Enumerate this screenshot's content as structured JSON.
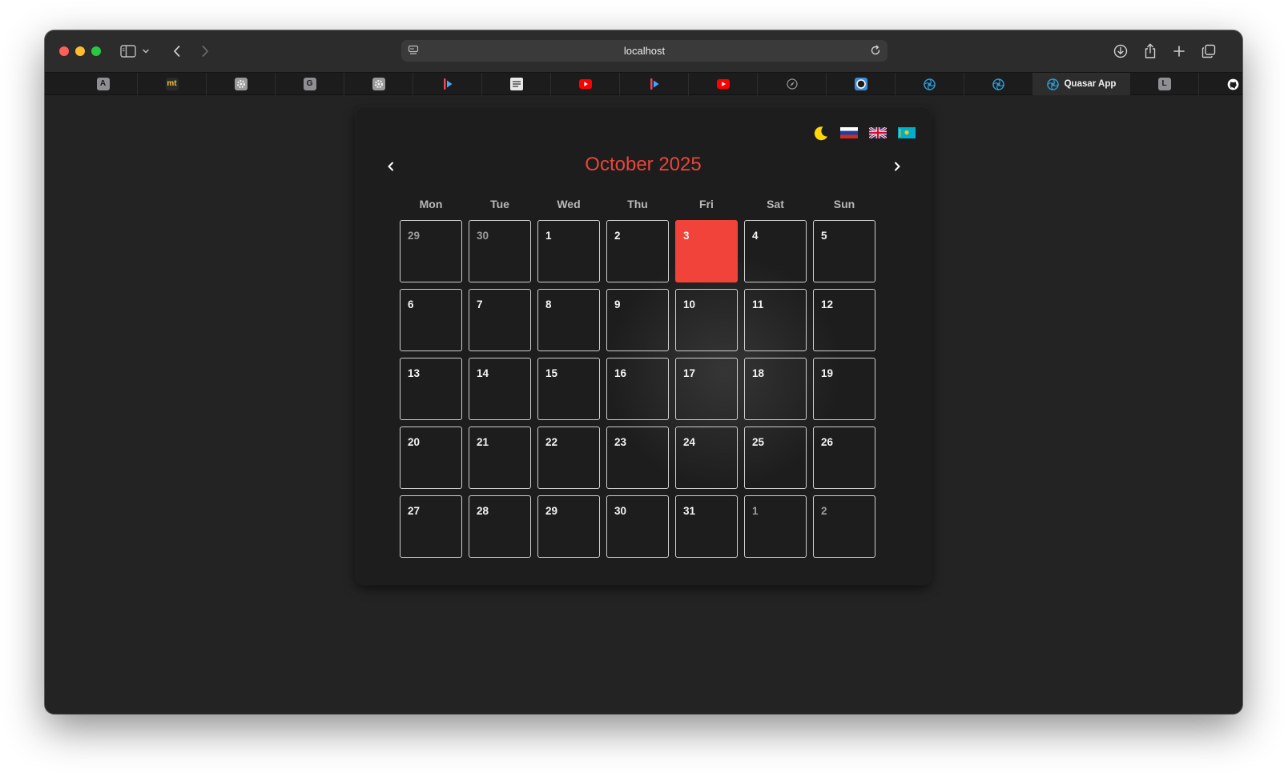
{
  "browser": {
    "url": "localhost",
    "tabs": [
      {
        "icon": "letter-a-favicon",
        "glyph": "A",
        "bg": "#8e8e93",
        "fg": "#1c1c1c"
      },
      {
        "icon": "mt-favicon",
        "glyph": "mt",
        "bg": "#2a2a2a",
        "fg": "#f2c230"
      },
      {
        "icon": "grey-gear-favicon",
        "glyph": "",
        "bg": "#9a9a9a",
        "fg": "#ffffff"
      },
      {
        "icon": "letter-g-favicon",
        "glyph": "G",
        "bg": "#8e8e93",
        "fg": "#1c1c1c"
      },
      {
        "icon": "grey-gear-favicon",
        "glyph": "",
        "bg": "#9a9a9a",
        "fg": "#ffffff"
      },
      {
        "icon": "streaming-app-favicon",
        "glyph": "",
        "bg": "#1c1c1c",
        "fg": "#e8465e"
      },
      {
        "icon": "document-favicon",
        "glyph": "",
        "bg": "#e8e8e8",
        "fg": "#222222"
      },
      {
        "icon": "youtube-favicon",
        "glyph": "",
        "bg": "#ff0000",
        "fg": "#ffffff"
      },
      {
        "icon": "streaming-app-favicon",
        "glyph": "",
        "bg": "#1c1c1c",
        "fg": "#e8465e"
      },
      {
        "icon": "youtube-favicon",
        "glyph": "",
        "bg": "#ff0000",
        "fg": "#ffffff"
      },
      {
        "icon": "compass-favicon",
        "glyph": "",
        "bg": "#1c1c1c",
        "fg": "#9a9a9a"
      },
      {
        "icon": "blue-circle-favicon",
        "glyph": "",
        "bg": "#3d8bd4",
        "fg": "#ffffff"
      },
      {
        "icon": "quasar-favicon",
        "glyph": "",
        "bg": "#1c1c1c",
        "fg": "#2a9bd8"
      },
      {
        "icon": "quasar-favicon",
        "glyph": "",
        "bg": "#1c1c1c",
        "fg": "#2a9bd8"
      },
      {
        "icon": "quasar-favicon",
        "glyph": "",
        "bg": "#1c1c1c",
        "fg": "#2a9bd8",
        "label": "Quasar App",
        "active": true
      },
      {
        "icon": "letter-l-favicon",
        "glyph": "L",
        "bg": "#8e8e93",
        "fg": "#1c1c1c"
      },
      {
        "icon": "github-favicon",
        "glyph": "",
        "bg": "#1c1c1c",
        "fg": "#ffffff"
      }
    ]
  },
  "calendar": {
    "title": "October 2025",
    "accent": "#e8463a",
    "today_color": "#f2433a",
    "languages": [
      "Russian",
      "English",
      "Kazakh"
    ],
    "weekdays": [
      "Mon",
      "Tue",
      "Wed",
      "Thu",
      "Fri",
      "Sat",
      "Sun"
    ],
    "weeks": [
      [
        {
          "d": "29",
          "muted": true
        },
        {
          "d": "30",
          "muted": true
        },
        {
          "d": "1"
        },
        {
          "d": "2"
        },
        {
          "d": "3",
          "today": true
        },
        {
          "d": "4"
        },
        {
          "d": "5"
        }
      ],
      [
        {
          "d": "6"
        },
        {
          "d": "7"
        },
        {
          "d": "8"
        },
        {
          "d": "9"
        },
        {
          "d": "10"
        },
        {
          "d": "11"
        },
        {
          "d": "12"
        }
      ],
      [
        {
          "d": "13"
        },
        {
          "d": "14"
        },
        {
          "d": "15"
        },
        {
          "d": "16"
        },
        {
          "d": "17"
        },
        {
          "d": "18"
        },
        {
          "d": "19"
        }
      ],
      [
        {
          "d": "20"
        },
        {
          "d": "21"
        },
        {
          "d": "22"
        },
        {
          "d": "23"
        },
        {
          "d": "24"
        },
        {
          "d": "25"
        },
        {
          "d": "26"
        }
      ],
      [
        {
          "d": "27"
        },
        {
          "d": "28"
        },
        {
          "d": "29"
        },
        {
          "d": "30"
        },
        {
          "d": "31"
        },
        {
          "d": "1",
          "muted": true
        },
        {
          "d": "2",
          "muted": true
        }
      ]
    ]
  }
}
